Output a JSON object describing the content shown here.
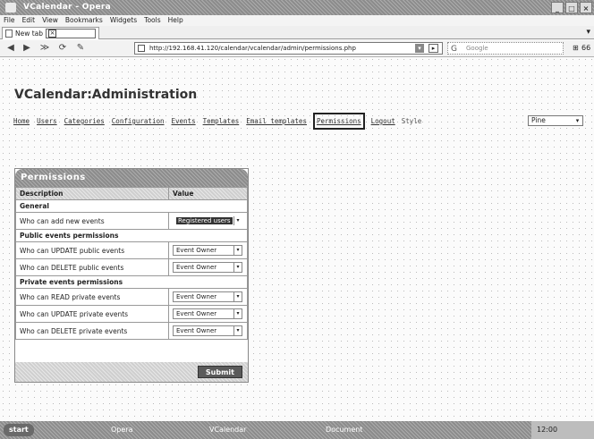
{
  "window": {
    "title": "VCalendar - Opera",
    "buttons": [
      "_",
      "□",
      "×"
    ]
  },
  "menubar": {
    "items": [
      "File",
      "Edit",
      "View",
      "Bookmarks",
      "Widgets",
      "Tools",
      "Help"
    ]
  },
  "tabs": [
    {
      "label": "New tab"
    }
  ],
  "tabstrip": {
    "close_label": "×",
    "menu_icon": "▾"
  },
  "navbar": {
    "url": "http://192.168.41.120/calendar/vcalendar/admin/permissions.php",
    "search_placeholder": "Google",
    "zoom_value": "66",
    "buttons": [
      "◀",
      "▶",
      "≫",
      "⟳",
      "✎"
    ],
    "go_label": "▸",
    "dropdown_label": "▾",
    "search_icon": "G",
    "zoom_icon": "⊞"
  },
  "app": {
    "heading": "VCalendar:Administration",
    "menu": [
      {
        "label": "Home",
        "active": false
      },
      {
        "label": "Users",
        "active": false
      },
      {
        "label": "Categories",
        "active": false
      },
      {
        "label": "Configuration",
        "active": false
      },
      {
        "label": "Events",
        "active": false
      },
      {
        "label": "Templates",
        "active": false
      },
      {
        "label": "Email templates",
        "active": false
      },
      {
        "label": "Permissions",
        "active": true
      },
      {
        "label": "Logout",
        "active": false
      }
    ],
    "style_label": "Style",
    "style_value": "Pine",
    "style_arrow": "▾"
  },
  "permissions": {
    "title": "Permissions",
    "col_description": "Description",
    "col_value": "Value",
    "sections": [
      {
        "name": "General",
        "rows": [
          {
            "label": "Who can add new events",
            "value": "Registered users",
            "selected": true
          }
        ]
      },
      {
        "name": "Public events permissions",
        "rows": [
          {
            "label": "Who can UPDATE public events",
            "value": "Event Owner",
            "selected": false
          },
          {
            "label": "Who can DELETE public events",
            "value": "Event Owner",
            "selected": false
          }
        ]
      },
      {
        "name": "Private events permissions",
        "rows": [
          {
            "label": "Who can READ private events",
            "value": "Event Owner",
            "selected": false
          },
          {
            "label": "Who can UPDATE private events",
            "value": "Event Owner",
            "selected": false
          },
          {
            "label": "Who can DELETE private events",
            "value": "Event Owner",
            "selected": false
          }
        ]
      }
    ],
    "select_arrow": "▾",
    "save_label": "Submit"
  },
  "taskbar": {
    "start_label": "start",
    "items": [
      "Opera",
      "VCalendar",
      "Document"
    ],
    "clock": "12:00"
  }
}
